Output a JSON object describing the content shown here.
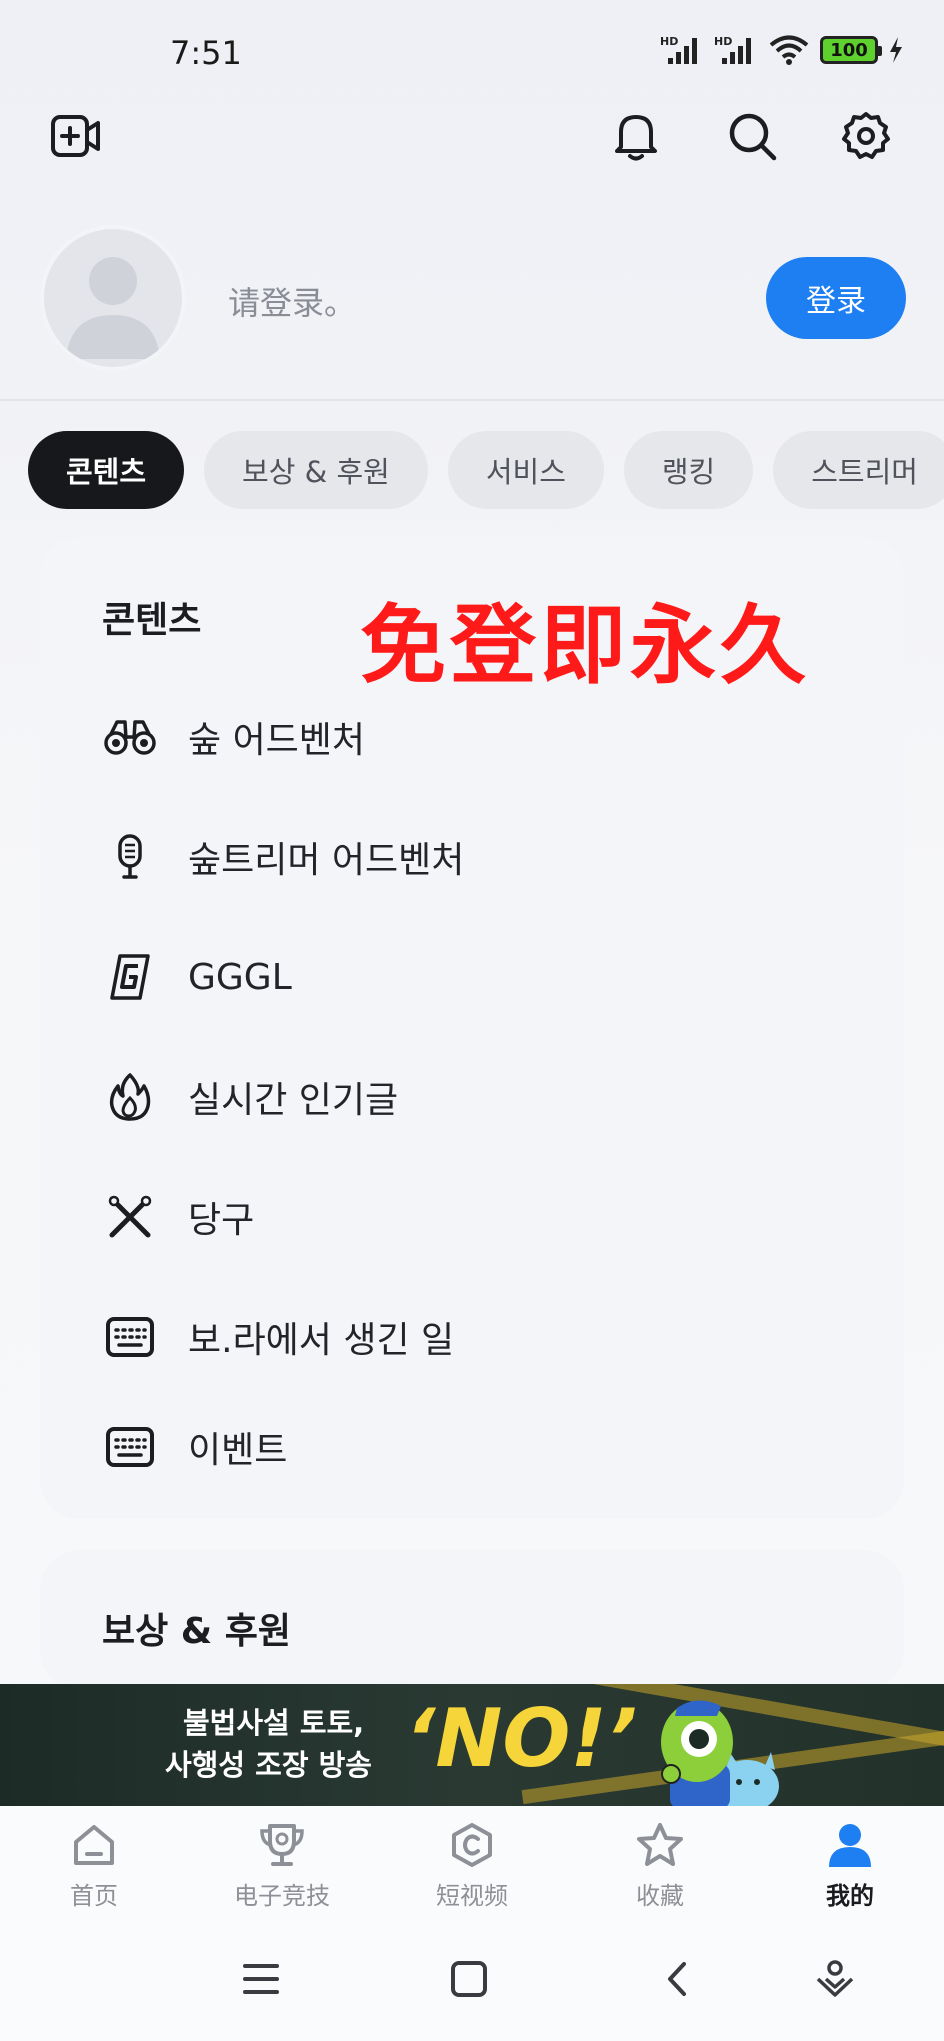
{
  "status_bar": {
    "time": "7:51",
    "battery": "100",
    "signal_1": "HD",
    "signal_2": "HD"
  },
  "header_icons": [
    "video-add-icon",
    "bell-icon",
    "search-icon",
    "settings-icon"
  ],
  "profile": {
    "login_hint": "请登录。",
    "login_button": "登录"
  },
  "tabs": [
    {
      "label": "콘텐츠",
      "active": true
    },
    {
      "label": "보상 & 후원",
      "active": false
    },
    {
      "label": "서비스",
      "active": false
    },
    {
      "label": "랭킹",
      "active": false
    },
    {
      "label": "스트리머",
      "active": false
    }
  ],
  "overlay_text": "免登即永久",
  "content_section": {
    "title": "콘텐츠",
    "items": [
      {
        "label": "숲 어드벤처",
        "icon": "binoculars-icon"
      },
      {
        "label": "숲트리머 어드벤처",
        "icon": "microphone-icon"
      },
      {
        "label": "GGGL",
        "icon": "gggl-logo-icon"
      },
      {
        "label": "실시간 인기글",
        "icon": "fire-icon"
      },
      {
        "label": "당구",
        "icon": "cue-sticks-icon"
      },
      {
        "label": "보.라에서 생긴 일",
        "icon": "keyboard-icon"
      },
      {
        "label": "이벤트",
        "icon": "keyboard-icon"
      }
    ]
  },
  "reward_section": {
    "title": "보상 & 후원"
  },
  "banner": {
    "line1": "불법사설 토토,",
    "line2": "사행성 조장 방송",
    "slogan": "‘NO!’"
  },
  "bottom_nav": [
    {
      "label": "首页",
      "icon": "home-icon",
      "active": false
    },
    {
      "label": "电子竞技",
      "icon": "trophy-icon",
      "active": false
    },
    {
      "label": "短视频",
      "icon": "short-video-icon",
      "active": false
    },
    {
      "label": "收藏",
      "icon": "star-icon",
      "active": false
    },
    {
      "label": "我的",
      "icon": "person-icon",
      "active": true
    }
  ],
  "colors": {
    "accent": "#1e7ff3",
    "overlay": "#ff1a1a",
    "active_tab": "#17181c"
  }
}
